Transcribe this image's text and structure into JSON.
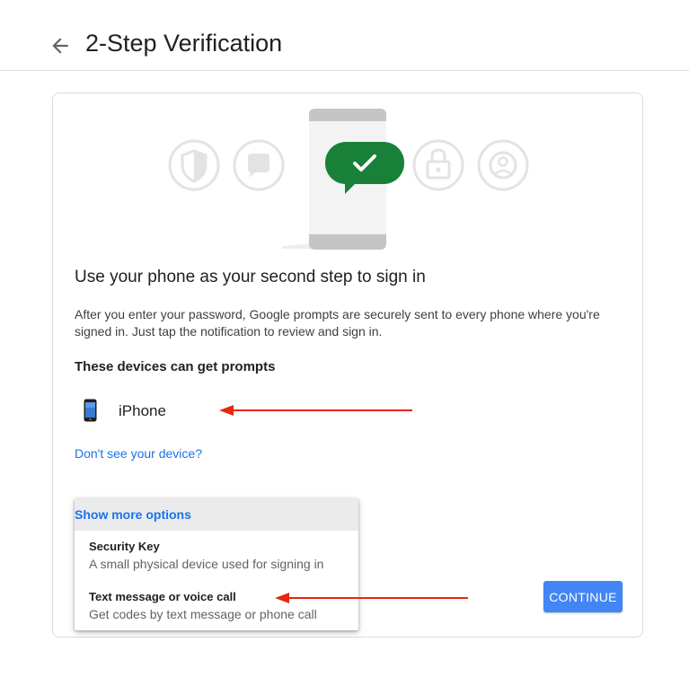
{
  "header": {
    "title": "2-Step Verification",
    "back_icon": "arrow-back-icon"
  },
  "content": {
    "heading": "Use your phone as your second step to sign in",
    "description": "After you enter your password, Google prompts are securely sent to every phone where you're signed in. Just tap the notification to review and sign in.",
    "devices_heading": "These devices can get prompts",
    "devices": [
      {
        "name": "iPhone",
        "icon": "iphone-icon"
      }
    ],
    "missing_device_link": "Don't see your device?"
  },
  "options_menu": {
    "header": "Show more options",
    "items": [
      {
        "title": "Security Key",
        "subtitle": "A small physical device used for signing in"
      },
      {
        "title": "Text message or voice call",
        "subtitle": "Get codes by text message or phone call"
      }
    ]
  },
  "actions": {
    "continue_label": "CONTINUE"
  },
  "colors": {
    "accent": "#4285f4",
    "link": "#1a73e8",
    "check_green": "#188038",
    "annotation_arrow": "#e8260f"
  }
}
